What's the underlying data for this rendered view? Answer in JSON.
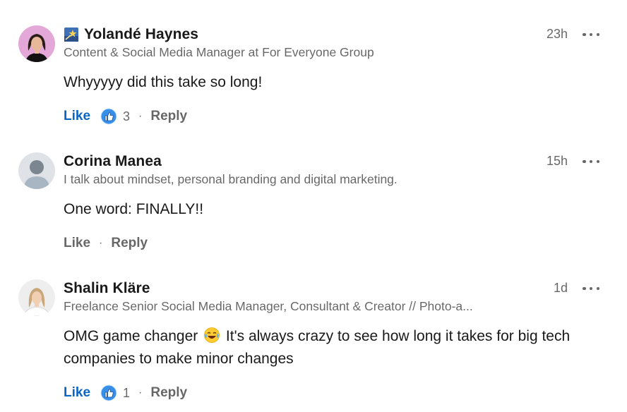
{
  "comments": [
    {
      "name": "Yolandé Haynes",
      "name_badge_icon": "shooting-star-icon",
      "headline": "Content & Social Media Manager at For Everyone Group",
      "time": "23h",
      "text": "Whyyyyy did this take so long!",
      "like_label": "Like",
      "like_active": true,
      "reaction_icon": "thumbs-up-icon",
      "reaction_count": "3",
      "separator": "·",
      "reply_label": "Reply"
    },
    {
      "name": "Corina Manea",
      "headline": "I talk about mindset, personal branding and digital marketing.",
      "time": "15h",
      "text": "One word: FINALLY!!",
      "like_label": "Like",
      "like_active": false,
      "separator": "·",
      "reply_label": "Reply"
    },
    {
      "name": "Shalin Kläre",
      "headline": "Freelance Senior Social Media Manager, Consultant & Creator // Photo-a...",
      "time": "1d",
      "text_before_emoji": "OMG game changer ",
      "text_emoji_icon": "tears-of-joy-emoji-icon",
      "text_after_emoji": " It's always crazy to see how long it takes for big tech companies to make minor changes",
      "like_label": "Like",
      "like_active": true,
      "reaction_icon": "thumbs-up-icon",
      "reaction_count": "1",
      "separator": "·",
      "reply_label": "Reply"
    }
  ],
  "colors": {
    "like_active": "#0a66c2",
    "secondary_text": "#666666",
    "primary_text": "#191919"
  }
}
